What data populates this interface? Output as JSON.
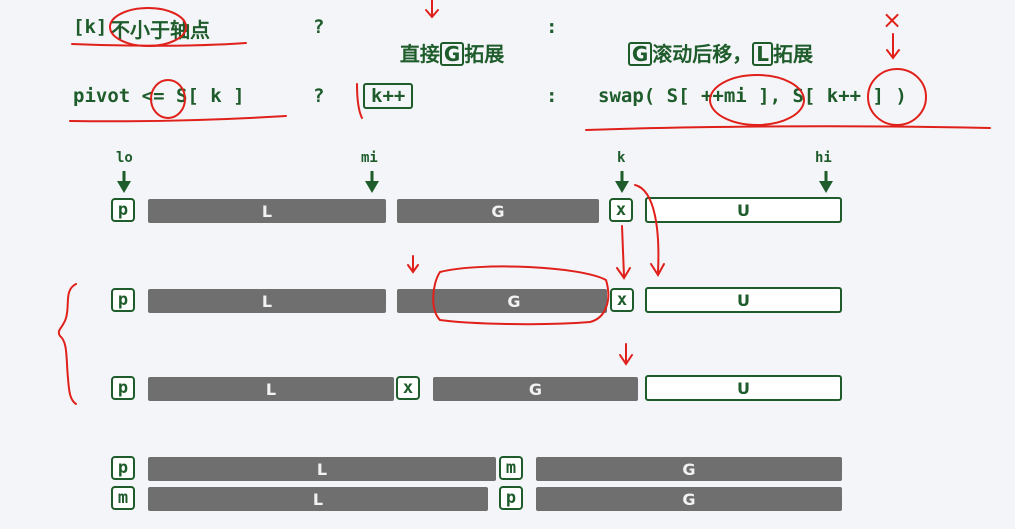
{
  "rules": {
    "row1": {
      "cond_prefix": "[k]",
      "cond_text": "不小于轴点",
      "q": "?",
      "then_prefix": "直接",
      "then_box": "G",
      "then_suffix": "拓展",
      "colon": ":",
      "else_box1": "G",
      "else_text1": "滚动后移，",
      "else_box2": "L",
      "else_text2": "拓展"
    },
    "row2": {
      "cond": "pivot <= S[ k ]",
      "q": "?",
      "then": "k++",
      "colon": ":",
      "else": "swap( S[ ++mi ], S[ k++ ] )"
    }
  },
  "pointers": {
    "lo": "lo",
    "mi": "mi",
    "k": "k",
    "hi": "hi"
  },
  "rows": {
    "r1": {
      "p": "p",
      "L": "L",
      "G": "G",
      "x": "x",
      "U": "U"
    },
    "r2": {
      "p": "p",
      "L": "L",
      "G": "G",
      "x": "x",
      "U": "U"
    },
    "r3": {
      "p": "p",
      "L": "L",
      "x": "x",
      "G": "G",
      "U": "U"
    },
    "r4": {
      "p": "p",
      "L": "L",
      "m": "m",
      "G": "G"
    },
    "r5": {
      "m": "m",
      "L": "L",
      "p": "p",
      "G": "G"
    }
  },
  "annotation_mark": "×",
  "colors": {
    "green": "#1e5c2b",
    "gray": "#6f6f6f",
    "annotation_red": "#e0201a"
  }
}
